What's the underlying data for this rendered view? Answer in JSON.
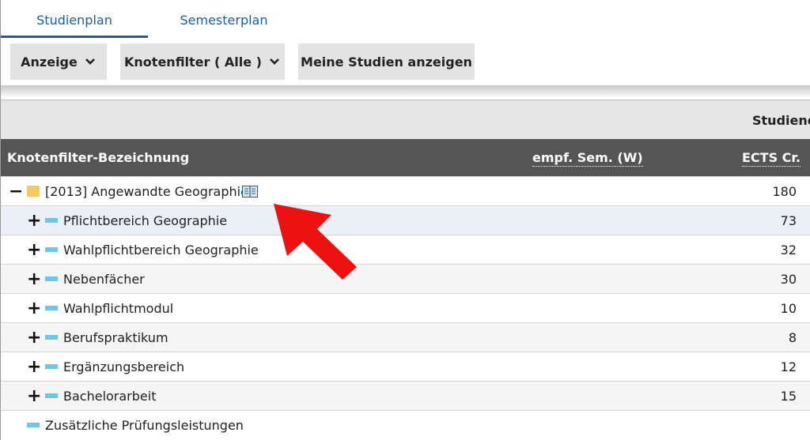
{
  "tabs": [
    {
      "label": "Studienplan",
      "active": true
    },
    {
      "label": "Semesterplan",
      "active": false
    }
  ],
  "toolbar": {
    "anzeige_label": "Anzeige",
    "knotenfilter_label": "Knotenfilter ( Alle )",
    "meine_studien_label": "Meine Studien anzeigen"
  },
  "band": {
    "title": "Studiene"
  },
  "table": {
    "headers": {
      "name": "Knotenfilter-Bezeichnung",
      "sem": "empf. Sem. (W)",
      "ects": "ECTS Cr."
    },
    "root": {
      "label": "[2013] Angewandte Geographie",
      "ects": "180",
      "toggle": "−"
    },
    "rows": [
      {
        "label": "Pflichtbereich Geographie",
        "ects": "73",
        "toggle": "+"
      },
      {
        "label": "Wahlpflichtbereich Geographie",
        "ects": "32",
        "toggle": "+"
      },
      {
        "label": "Nebenfächer",
        "ects": "30",
        "toggle": "+"
      },
      {
        "label": "Wahlpflichtmodul",
        "ects": "10",
        "toggle": "+"
      },
      {
        "label": "Berufspraktikum",
        "ects": "8",
        "toggle": "+"
      },
      {
        "label": "Ergänzungsbereich",
        "ects": "12",
        "toggle": "+"
      },
      {
        "label": "Bachelorarbeit",
        "ects": "15",
        "toggle": "+"
      }
    ],
    "extra": {
      "label": "Zusätzliche Prüfungsleistungen"
    }
  },
  "colors": {
    "tab_accent": "#1f5c99",
    "header_bg": "#555555",
    "marker": "#6cc8e6",
    "folder": "#f4c95d",
    "arrow": "#ee1111"
  },
  "icons": [
    "chevron-down-icon",
    "book-icon",
    "folder-icon",
    "red-arrow-annotation"
  ]
}
